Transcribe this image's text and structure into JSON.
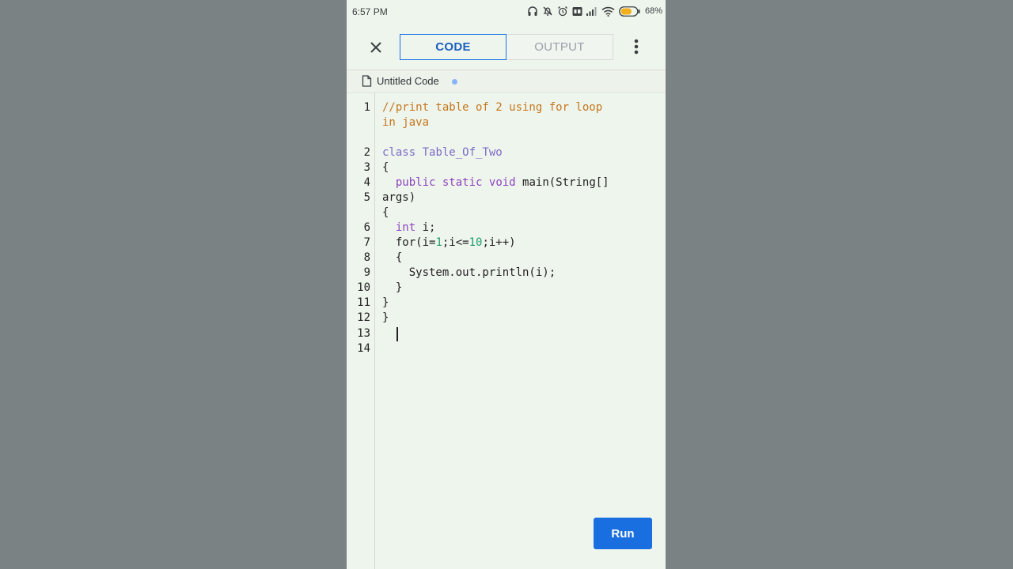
{
  "status_bar": {
    "time": "6:57 PM",
    "battery": "68%",
    "battery_color": "#f2b01e"
  },
  "appbar": {
    "tabs": [
      {
        "label": "CODE",
        "active": true
      },
      {
        "label": "OUTPUT",
        "active": false
      }
    ]
  },
  "file": {
    "name": "Untitled Code",
    "unsaved_dot_color": "#8ab4f8"
  },
  "editor": {
    "line_numbers": [
      "1",
      "2",
      "3",
      "4",
      "5",
      "6",
      "7",
      "8",
      "9",
      "10",
      "11",
      "12",
      "13",
      "14"
    ],
    "lines": [
      "//print table of 2 using for loop",
      "in java",
      "",
      "class Table_Of_Two",
      "{",
      "  public static void main(String[]",
      "args)",
      "{",
      "  int i;",
      "  for(i=1;i<=10;i++)",
      "  {",
      "    System.out.println(i);",
      "  }",
      "}",
      "}",
      "  "
    ]
  },
  "run_button": {
    "label": "Run",
    "color": "#1a6fe0"
  }
}
